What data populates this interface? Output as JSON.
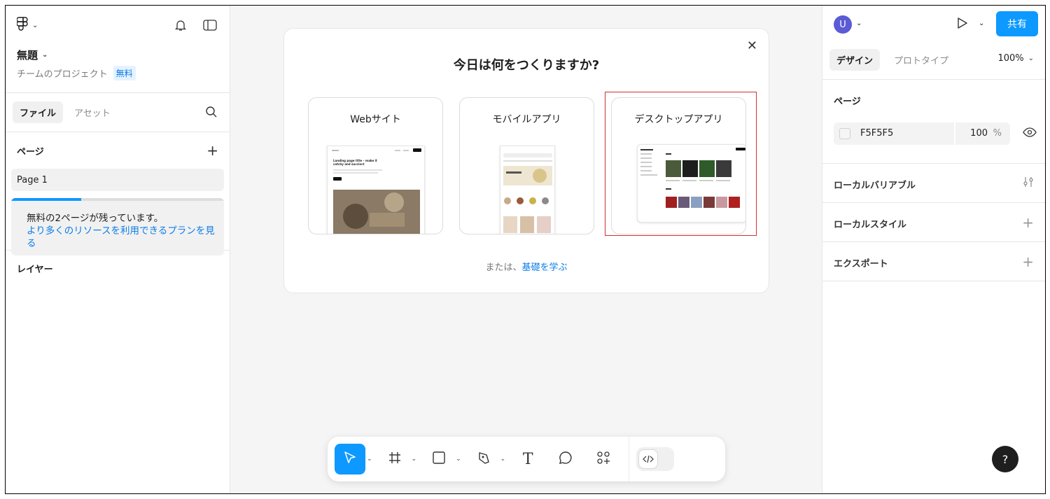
{
  "left_panel": {
    "file_title": "無題",
    "project_name": "チームのプロジェクト",
    "plan_badge": "無料",
    "tabs": [
      "ファイル",
      "アセット"
    ],
    "pages_heading": "ページ",
    "pages": [
      "Page 1"
    ],
    "upsell_line1": "無料の2ページが残っています。",
    "upsell_link": "より多くのリソースを利用できるプランを見る",
    "upsell_progress": 0.33,
    "layers_heading": "レイヤー"
  },
  "modal": {
    "title": "今日は何をつくりますか?",
    "cards": [
      "Webサイト",
      "モバイルアプリ",
      "デスクトップアプリ"
    ],
    "footer_prefix": "または、",
    "footer_link": "基礎を学ぶ",
    "web_thumb_headline": "Landing page title – make it catchy and succinct"
  },
  "right_panel": {
    "avatar_initial": "U",
    "share_label": "共有",
    "tabs": [
      "デザイン",
      "プロトタイプ"
    ],
    "zoom": "100%",
    "page_section": "ページ",
    "bg_hex": "F5F5F5",
    "bg_opacity": "100",
    "bg_opacity_unit": "%",
    "local_variables": "ローカルバリアブル",
    "local_styles": "ローカルスタイル",
    "export": "エクスポート",
    "help": "?"
  },
  "colors": {
    "accent": "#0d99ff",
    "highlight_box": "#d32f2f"
  }
}
